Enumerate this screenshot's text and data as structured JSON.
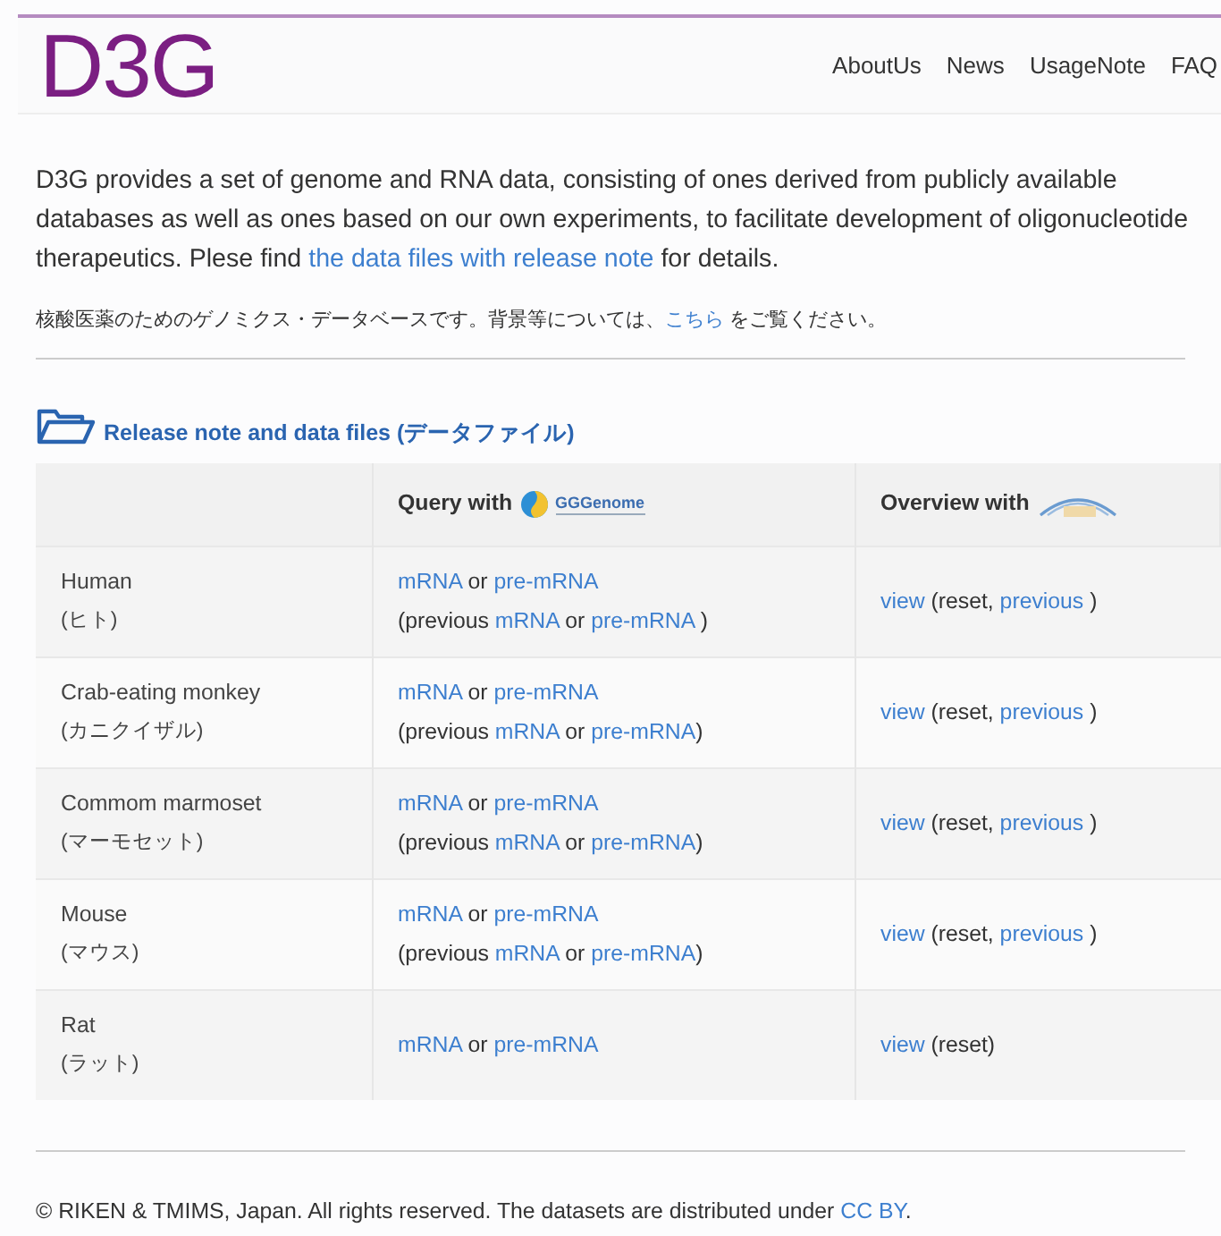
{
  "header": {
    "logo": "D3G",
    "nav": [
      {
        "label": "AboutUs"
      },
      {
        "label": "News"
      },
      {
        "label": "UsageNote"
      },
      {
        "label": "FAQ"
      }
    ]
  },
  "intro": [
    {
      "text": "D3G provides a set of genome and RNA data, consisting of ones derived from publicly available databases as well as ones based on our own experiments, to facilitate development of oligonucleotide therapeutics. Plese find ",
      "kind": "text"
    },
    {
      "text": "the data files with release note",
      "kind": "link"
    },
    {
      "text": " for details.",
      "kind": "text"
    }
  ],
  "intro_ja": [
    {
      "text": "核酸医薬のためのゲノミクス・データベースです。背景等については、",
      "kind": "text"
    },
    {
      "text": "こちら",
      "kind": "link"
    },
    {
      "text": " をご覧ください。",
      "kind": "text"
    }
  ],
  "section_title": "Release note and data files (データファイル)",
  "table": {
    "columns": [
      {
        "label": "Query with",
        "logo_text": "GGGenome"
      },
      {
        "label": "Overview with"
      }
    ],
    "rows": [
      {
        "name": "Human",
        "name_ja": "(ヒト)",
        "query": [
          [
            {
              "text": "mRNA",
              "kind": "link"
            },
            {
              "text": " or ",
              "kind": "text"
            },
            {
              "text": "pre-mRNA",
              "kind": "link"
            }
          ],
          [
            {
              "text": "(previous ",
              "kind": "text"
            },
            {
              "text": "mRNA",
              "kind": "link"
            },
            {
              "text": " or ",
              "kind": "text"
            },
            {
              "text": "pre-mRNA",
              "kind": "link"
            },
            {
              "text": " )",
              "kind": "text"
            }
          ]
        ],
        "overview": [
          {
            "text": "view",
            "kind": "link"
          },
          {
            "text": " (reset, ",
            "kind": "text"
          },
          {
            "text": "previous",
            "kind": "link"
          },
          {
            "text": " )",
            "kind": "text"
          }
        ]
      },
      {
        "name": "Crab-eating monkey",
        "name_ja": "(カニクイザル)",
        "query": [
          [
            {
              "text": "mRNA",
              "kind": "link"
            },
            {
              "text": " or ",
              "kind": "text"
            },
            {
              "text": "pre-mRNA",
              "kind": "link"
            }
          ],
          [
            {
              "text": "(previous ",
              "kind": "text"
            },
            {
              "text": "mRNA",
              "kind": "link"
            },
            {
              "text": " or ",
              "kind": "text"
            },
            {
              "text": "pre-mRNA",
              "kind": "link"
            },
            {
              "text": ")",
              "kind": "text"
            }
          ]
        ],
        "overview": [
          {
            "text": "view",
            "kind": "link"
          },
          {
            "text": " (reset, ",
            "kind": "text"
          },
          {
            "text": "previous",
            "kind": "link"
          },
          {
            "text": " )",
            "kind": "text"
          }
        ]
      },
      {
        "name": "Commom marmoset",
        "name_ja": "(マーモセット)",
        "query": [
          [
            {
              "text": "mRNA",
              "kind": "link"
            },
            {
              "text": " or ",
              "kind": "text"
            },
            {
              "text": "pre-mRNA",
              "kind": "link"
            }
          ],
          [
            {
              "text": "(previous ",
              "kind": "text"
            },
            {
              "text": "mRNA",
              "kind": "link"
            },
            {
              "text": " or ",
              "kind": "text"
            },
            {
              "text": "pre-mRNA",
              "kind": "link"
            },
            {
              "text": ")",
              "kind": "text"
            }
          ]
        ],
        "overview": [
          {
            "text": "view",
            "kind": "link"
          },
          {
            "text": " (reset, ",
            "kind": "text"
          },
          {
            "text": "previous",
            "kind": "link"
          },
          {
            "text": " )",
            "kind": "text"
          }
        ]
      },
      {
        "name": "Mouse",
        "name_ja": "(マウス)",
        "query": [
          [
            {
              "text": "mRNA",
              "kind": "link"
            },
            {
              "text": " or ",
              "kind": "text"
            },
            {
              "text": "pre-mRNA",
              "kind": "link"
            }
          ],
          [
            {
              "text": "(previous ",
              "kind": "text"
            },
            {
              "text": "mRNA",
              "kind": "link"
            },
            {
              "text": " or ",
              "kind": "text"
            },
            {
              "text": "pre-mRNA",
              "kind": "link"
            },
            {
              "text": ")",
              "kind": "text"
            }
          ]
        ],
        "overview": [
          {
            "text": "view",
            "kind": "link"
          },
          {
            "text": " (reset, ",
            "kind": "text"
          },
          {
            "text": "previous",
            "kind": "link"
          },
          {
            "text": " )",
            "kind": "text"
          }
        ]
      },
      {
        "name": "Rat",
        "name_ja": "(ラット)",
        "query": [
          [
            {
              "text": "mRNA",
              "kind": "link"
            },
            {
              "text": " or ",
              "kind": "text"
            },
            {
              "text": "pre-mRNA",
              "kind": "link"
            }
          ]
        ],
        "overview": [
          {
            "text": "view",
            "kind": "link"
          },
          {
            "text": " (reset)",
            "kind": "text"
          }
        ]
      }
    ]
  },
  "footer": [
    {
      "text": "© RIKEN & TMIMS, Japan. All rights reserved. The datasets are distributed under ",
      "kind": "text"
    },
    {
      "text": "CC BY",
      "kind": "link"
    },
    {
      "text": ".",
      "kind": "text"
    }
  ]
}
